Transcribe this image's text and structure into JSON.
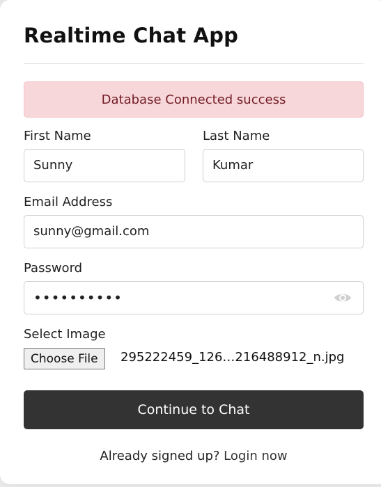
{
  "app": {
    "title": "Realtime Chat App"
  },
  "alert": {
    "message": "Database Connected success"
  },
  "form": {
    "first_name": {
      "label": "First Name",
      "value": "Sunny"
    },
    "last_name": {
      "label": "Last Name",
      "value": "Kumar"
    },
    "email": {
      "label": "Email Address",
      "value": "sunny@gmail.com"
    },
    "password": {
      "label": "Password",
      "masked_value": "••••••••••"
    },
    "image": {
      "label": "Select Image",
      "button_label": "Choose File",
      "file_name": "295222459_126…216488912_n.jpg"
    },
    "submit_label": "Continue to Chat"
  },
  "footer": {
    "text": "Already signed up?",
    "link_label": "Login now"
  },
  "colors": {
    "alert_bg": "#f8d7da",
    "alert_text": "#721c24",
    "button_bg": "#333333"
  }
}
